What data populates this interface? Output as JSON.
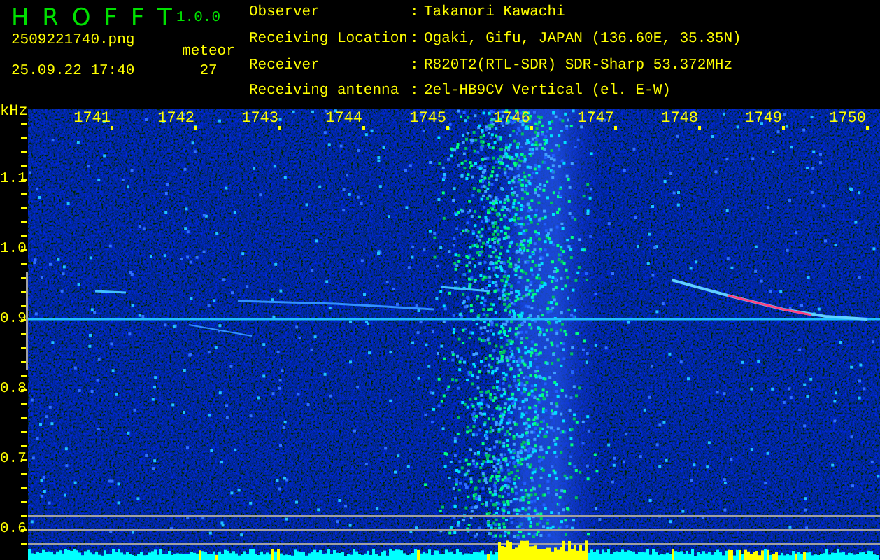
{
  "app": {
    "name": "H R O F F T",
    "version": "1.0.0"
  },
  "file": {
    "name": "2509221740.png",
    "timestamp": "25.09.22 17:40"
  },
  "meteor": {
    "label": "meteor",
    "count": "27"
  },
  "info": [
    {
      "label": "Observer",
      "separator": ":",
      "value": "Takanori Kawachi"
    },
    {
      "label": "Receiving Location",
      "separator": ":",
      "value": "Ogaki, Gifu, JAPAN (136.60E, 35.35N)"
    },
    {
      "label": "Receiver",
      "separator": ":",
      "value": "R820T2(RTL-SDR) SDR-Sharp 53.372MHz"
    },
    {
      "label": "Receiving antenna",
      "separator": ":",
      "value": "2el-HB9CV Vertical (el. E-W)"
    }
  ],
  "axis": {
    "unit": "kHz",
    "x_ticks": [
      "1741",
      "1742",
      "1743",
      "1744",
      "1745",
      "1746",
      "1747",
      "1748",
      "1749",
      "1750"
    ],
    "y_ticks": [
      "1.1",
      "1.0",
      "0.9",
      "0.8",
      "0.7",
      "0.6"
    ]
  }
}
